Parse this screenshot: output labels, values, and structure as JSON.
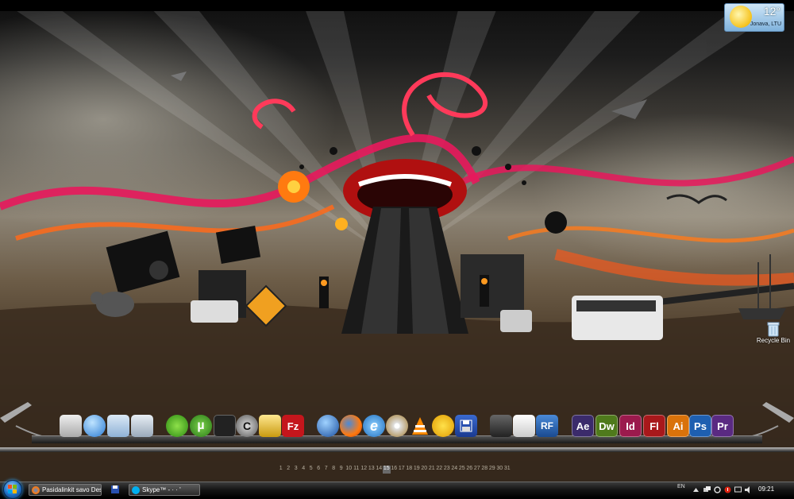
{
  "desktop": {
    "weather": {
      "temperature": "12°",
      "location": "Jonava, LTU"
    },
    "recycle_bin": {
      "label": "Recycle Bin",
      "icon": "recycle-bin-icon"
    }
  },
  "dock": {
    "items": [
      {
        "name": "system-icon",
        "label": ""
      },
      {
        "name": "network-globe-icon",
        "label": ""
      },
      {
        "name": "folder-icon",
        "label": ""
      },
      {
        "name": "calculator-icon",
        "label": ""
      },
      {
        "name": "media-player-icon",
        "label": ""
      },
      {
        "name": "utorrent-icon",
        "label": "µ"
      },
      {
        "name": "steam-icon",
        "label": ""
      },
      {
        "name": "ccleaner-icon",
        "label": "C"
      },
      {
        "name": "foobar-icon",
        "label": ""
      },
      {
        "name": "filezilla-icon",
        "label": "Fz"
      },
      {
        "name": "google-earth-icon",
        "label": ""
      },
      {
        "name": "firefox-icon",
        "label": ""
      },
      {
        "name": "internet-explorer-icon",
        "label": "e"
      },
      {
        "name": "disc-icon",
        "label": ""
      },
      {
        "name": "vlc-icon",
        "label": ""
      },
      {
        "name": "aim-icon",
        "label": ""
      },
      {
        "name": "save-icon",
        "label": ""
      },
      {
        "name": "inkscape-icon",
        "label": ""
      },
      {
        "name": "zbrush-icon",
        "label": ""
      },
      {
        "name": "realflow-icon",
        "label": "RF"
      },
      {
        "name": "after-effects-icon",
        "label": "Ae"
      },
      {
        "name": "dreamweaver-icon",
        "label": "Dw"
      },
      {
        "name": "indesign-icon",
        "label": "Id"
      },
      {
        "name": "flash-icon",
        "label": "Fl"
      },
      {
        "name": "illustrator-icon",
        "label": "Ai"
      },
      {
        "name": "photoshop-icon",
        "label": "Ps"
      },
      {
        "name": "premiere-icon",
        "label": "Pr"
      }
    ]
  },
  "calendar": {
    "days": [
      "1",
      "2",
      "3",
      "4",
      "5",
      "6",
      "7",
      "8",
      "9",
      "10",
      "11",
      "12",
      "13",
      "14",
      "15",
      "16",
      "17",
      "18",
      "19",
      "20",
      "21",
      "22",
      "23",
      "24",
      "25",
      "26",
      "27",
      "28",
      "29",
      "30",
      "31"
    ],
    "today": "15"
  },
  "taskbar": {
    "start_label": "Start",
    "buttons": [
      {
        "label": "Pasidalinkit savo Des...",
        "icon": "firefox-icon"
      },
      {
        "label": "Skype™ - ·  ·  '",
        "icon": "skype-icon"
      }
    ],
    "language": "EN",
    "clock": "09:21"
  },
  "colors": {
    "after_effects": "#3b2b6b",
    "dreamweaver": "#4f7a1c",
    "indesign": "#9b1a4d",
    "flash": "#a8181b",
    "illustrator": "#d9720a",
    "photoshop": "#1e5fb0",
    "premiere": "#5a2a82"
  }
}
